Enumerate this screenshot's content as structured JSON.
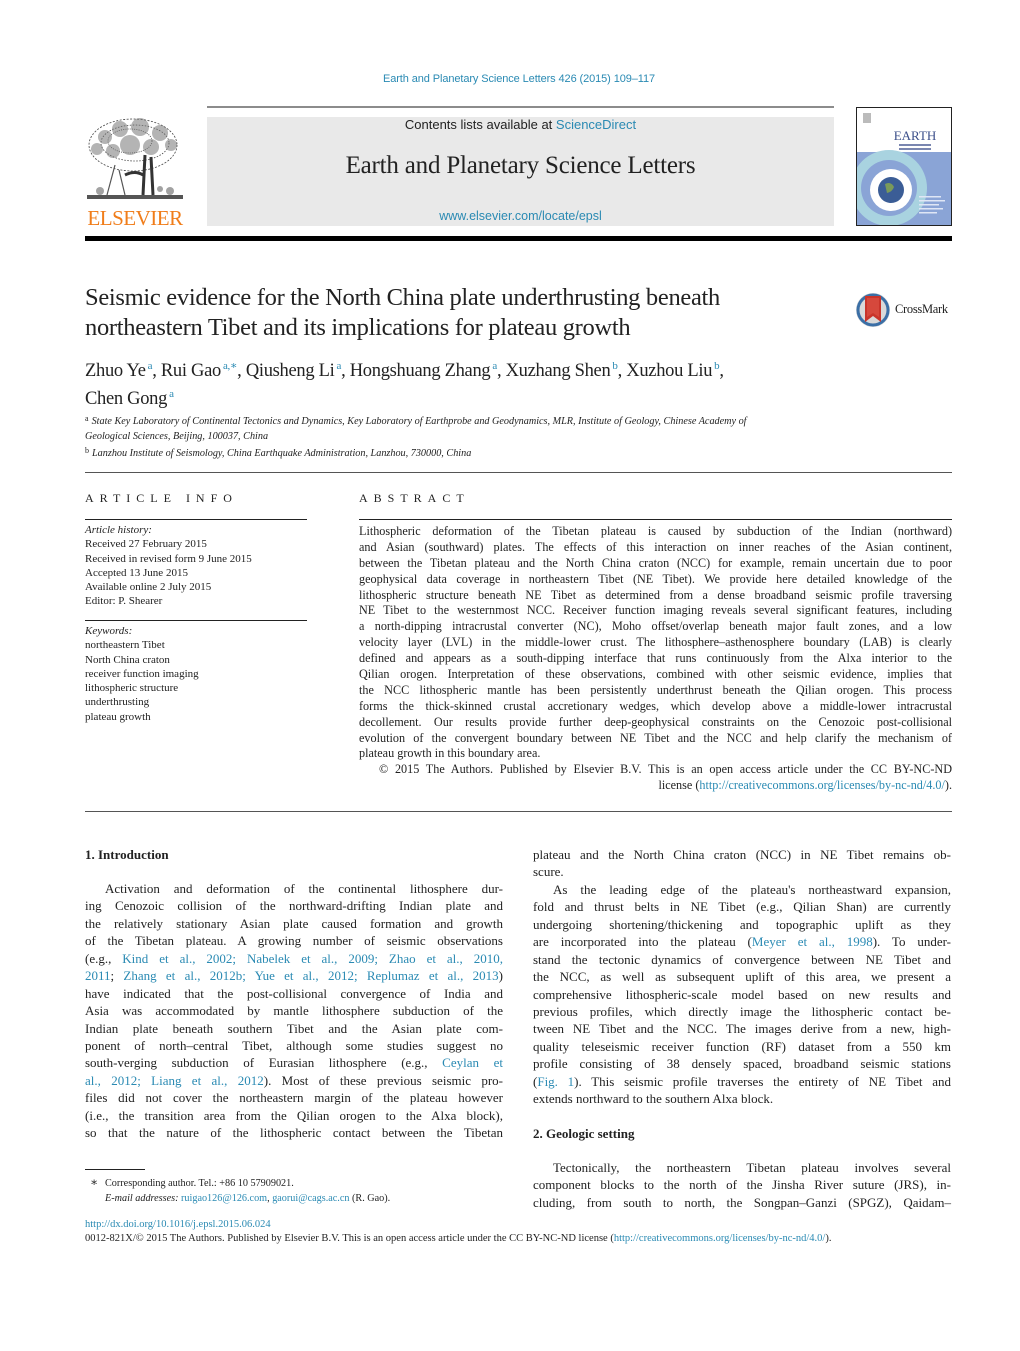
{
  "citation": "Earth and Planetary Science Letters 426 (2015) 109–117",
  "header": {
    "publisher_logo_text": "ELSEVIER",
    "contents_prefix": "Contents lists available at ",
    "contents_link": "ScienceDirect",
    "journal_title": "Earth and Planetary Science Letters",
    "journal_url": "www.elsevier.com/locate/epsl",
    "cover_title": "EARTH",
    "cover_subtitle": "& PLANETARY SCIENCE LETTERS"
  },
  "crossmark_label": "CrossMark",
  "article": {
    "title_lines": [
      "Seismic evidence for the North China plate underthrusting beneath",
      "northeastern Tibet and its implications for plateau growth"
    ],
    "authors": [
      {
        "name": "Zhuo Ye",
        "sup": "a",
        "sep": ", "
      },
      {
        "name": "Rui Gao",
        "sup": "a,∗",
        "sep": ", "
      },
      {
        "name": "Qiusheng Li",
        "sup": "a",
        "sep": ", "
      },
      {
        "name": "Hongshuang Zhang",
        "sup": "a",
        "sep": ", "
      },
      {
        "name": "Xuzhang Shen",
        "sup": "b",
        "sep": ", "
      },
      {
        "name": "Xuzhou Liu",
        "sup": "b",
        "sep": ","
      },
      {
        "name": "Chen Gong",
        "sup": "a",
        "sep": ""
      }
    ],
    "affiliations": [
      {
        "key": "a",
        "lines": [
          "State Key Laboratory of Continental Tectonics and Dynamics, Key Laboratory of Earthprobe and Geodynamics, MLR, Institute of Geology, Chinese Academy of",
          "Geological Sciences, Beijing, 100037, China"
        ]
      },
      {
        "key": "b",
        "lines": [
          "Lanzhou Institute of Seismology, China Earthquake Administration, Lanzhou, 730000, China"
        ]
      }
    ]
  },
  "article_info": {
    "heading": "ARTICLE INFO",
    "history_label": "Article history:",
    "history": [
      "Received 27 February 2015",
      "Received in revised form 9 June 2015",
      "Accepted 13 June 2015",
      "Available online 2 July 2015",
      "Editor: P. Shearer"
    ],
    "keywords_label": "Keywords:",
    "keywords": [
      "northeastern Tibet",
      "North China craton",
      "receiver function imaging",
      "lithospheric structure",
      "underthrusting",
      "plateau growth"
    ]
  },
  "abstract": {
    "heading": "ABSTRACT",
    "lines": [
      "Lithospheric deformation of the Tibetan plateau is caused by subduction of the Indian (northward)",
      "and Asian (southward) plates. The effects of this interaction on inner reaches of the Asian continent,",
      "between the Tibetan plateau and the North China craton (NCC) for example, remain uncertain due to poor",
      "geophysical data coverage in northeastern Tibet (NE Tibet). We provide here detailed knowledge of the",
      "lithospheric structure beneath NE Tibet as determined from a dense broadband seismic profile traversing",
      "NE Tibet to the westernmost NCC. Receiver function imaging reveals several significant features, including",
      "a north-dipping intracrustal converter (NC), Moho offset/overlap beneath major fault zones, and a low",
      "velocity layer (LVL) in the middle-lower crust. The lithosphere–asthenosphere boundary (LAB) is clearly",
      "defined and appears as a south-dipping interface that runs continuously from the Alxa interior to the",
      "Qilian orogen. Interpretation of these observations, combined with other seismic evidence, implies that",
      "the NCC lithospheric mantle has been persistently underthrust beneath the Qilian orogen. This process",
      "forms the thick-skinned crustal accretionary wedges, which develop above a middle-lower intracrustal",
      "decollement. Our results provide further deep-geophysical constraints on the Cenozoic post-collisional",
      "evolution of the convergent boundary between NE Tibet and the NCC and help clarify the mechanism of",
      "plateau growth in this boundary area."
    ],
    "copyright_line": "© 2015 The Authors. Published by Elsevier B.V. This is an open access article under the CC BY-NC-ND",
    "license_prefix": "license (",
    "license_link": "http://creativecommons.org/licenses/by-nc-nd/4.0/",
    "license_suffix": ")."
  },
  "body": {
    "left": [
      {
        "type": "heading",
        "text": "1.  Introduction"
      },
      {
        "type": "line",
        "indent": true,
        "segs": [
          {
            "t": "Activation and deformation of the continental lithosphere dur-"
          }
        ]
      },
      {
        "type": "line",
        "segs": [
          {
            "t": "ing Cenozoic collision of the northward-drifting Indian plate and"
          }
        ]
      },
      {
        "type": "line",
        "segs": [
          {
            "t": "the relatively stationary Asian plate caused formation and growth"
          }
        ]
      },
      {
        "type": "line",
        "segs": [
          {
            "t": "of the Tibetan plateau. A growing number of seismic observations"
          }
        ]
      },
      {
        "type": "line",
        "segs": [
          {
            "t": "(e.g., "
          },
          {
            "t": "Kind et al., 2002; Nabelek et al., 2009; Zhao et al., 2010,",
            "link": true
          }
        ]
      },
      {
        "type": "line",
        "segs": [
          {
            "t": "2011",
            "link": true
          },
          {
            "t": "; "
          },
          {
            "t": "Zhang et al., 2012b; Yue et al., 2012; Replumaz et al., 2013",
            "link": true
          },
          {
            "t": ")"
          }
        ]
      },
      {
        "type": "line",
        "segs": [
          {
            "t": "have indicated that the post-collisional convergence of India and"
          }
        ]
      },
      {
        "type": "line",
        "segs": [
          {
            "t": "Asia was accommodated by mantle lithosphere subduction of the"
          }
        ]
      },
      {
        "type": "line",
        "segs": [
          {
            "t": "Indian plate beneath southern Tibet and the Asian plate com-"
          }
        ]
      },
      {
        "type": "line",
        "segs": [
          {
            "t": "ponent of north–central Tibet, although some studies suggest no"
          }
        ]
      },
      {
        "type": "line",
        "segs": [
          {
            "t": "south-verging subduction of Eurasian lithosphere (e.g., "
          },
          {
            "t": "Ceylan et",
            "link": true
          }
        ]
      },
      {
        "type": "line",
        "segs": [
          {
            "t": "al., 2012; Liang et al., 2012",
            "link": true
          },
          {
            "t": "). Most of these previous seismic pro-"
          }
        ]
      },
      {
        "type": "line",
        "segs": [
          {
            "t": "files did not cover the northeastern margin of the plateau however"
          }
        ]
      },
      {
        "type": "line",
        "segs": [
          {
            "t": "(i.e., the transition area from the Qilian orogen to the Alxa block),"
          }
        ]
      },
      {
        "type": "line",
        "segs": [
          {
            "t": "so that the nature of the lithospheric contact between the Tibetan"
          }
        ]
      }
    ],
    "right": [
      {
        "type": "line",
        "segs": [
          {
            "t": "plateau and the North China craton (NCC) in NE Tibet remains ob-"
          }
        ]
      },
      {
        "type": "line",
        "last": true,
        "segs": [
          {
            "t": "scure."
          }
        ]
      },
      {
        "type": "line",
        "indent": true,
        "segs": [
          {
            "t": "As the leading edge of the plateau's northeastward expansion,"
          }
        ]
      },
      {
        "type": "line",
        "segs": [
          {
            "t": "fold and thrust belts in NE Tibet (e.g., Qilian Shan) are currently"
          }
        ]
      },
      {
        "type": "line",
        "segs": [
          {
            "t": "undergoing shortening/thickening and topographic uplift as they"
          }
        ]
      },
      {
        "type": "line",
        "segs": [
          {
            "t": "are incorporated into the plateau ("
          },
          {
            "t": "Meyer et al., 1998",
            "link": true
          },
          {
            "t": "). To under-"
          }
        ]
      },
      {
        "type": "line",
        "segs": [
          {
            "t": "stand the tectonic dynamics of convergence between NE Tibet and"
          }
        ]
      },
      {
        "type": "line",
        "segs": [
          {
            "t": "the NCC, as well as subsequent uplift of this area, we present a"
          }
        ]
      },
      {
        "type": "line",
        "segs": [
          {
            "t": "comprehensive lithospheric-scale model based on new results and"
          }
        ]
      },
      {
        "type": "line",
        "segs": [
          {
            "t": "previous profiles, which directly image the lithospheric contact be-"
          }
        ]
      },
      {
        "type": "line",
        "segs": [
          {
            "t": "tween NE Tibet and the NCC. The images derive from a new, high-"
          }
        ]
      },
      {
        "type": "line",
        "segs": [
          {
            "t": "quality teleseismic receiver function (RF) dataset from a 550 km"
          }
        ]
      },
      {
        "type": "line",
        "segs": [
          {
            "t": "profile consisting of 38 densely spaced, broadband seismic stations"
          }
        ]
      },
      {
        "type": "line",
        "segs": [
          {
            "t": "("
          },
          {
            "t": "Fig. 1",
            "link": true
          },
          {
            "t": "). This seismic profile traverses the entirety of NE Tibet and"
          }
        ]
      },
      {
        "type": "line",
        "last": true,
        "segs": [
          {
            "t": "extends northward to the southern Alxa block."
          }
        ]
      },
      {
        "type": "gap"
      },
      {
        "type": "heading",
        "text": "2.  Geologic setting"
      },
      {
        "type": "line",
        "indent": true,
        "segs": [
          {
            "t": "Tectonically, the northeastern Tibetan plateau involves several"
          }
        ]
      },
      {
        "type": "line",
        "segs": [
          {
            "t": "component blocks to the north of the Jinsha River suture (JRS), in-"
          }
        ]
      },
      {
        "type": "line",
        "segs": [
          {
            "t": "cluding, from south to north, the Songpan–Ganzi (SPGZ), Qaidam–"
          }
        ]
      }
    ]
  },
  "footnote": {
    "star": "∗",
    "line1": "Corresponding author. Tel.: +86 10 57909021.",
    "email_label": "E-mail addresses:",
    "email1": "ruigao126@126.com",
    "email_sep": ", ",
    "email2": "gaorui@cags.ac.cn",
    "email_suffix": " (R. Gao)."
  },
  "footer": {
    "doi": "http://dx.doi.org/10.1016/j.epsl.2015.06.024",
    "issn_text": "0012-821X/© 2015 The Authors. Published by Elsevier B.V. This is an open access article under the CC BY-NC-ND license (",
    "license_link": "http://creativecommons.org/licenses/by-nc-nd/4.0/",
    "license_suffix": ")."
  },
  "colors": {
    "link": "#2a8ab3",
    "elsevier_orange": "#f07d1a",
    "header_box": "#e9e9e9",
    "crossmark_red": "#c9342a",
    "crossmark_blue": "#3b6fa6"
  }
}
